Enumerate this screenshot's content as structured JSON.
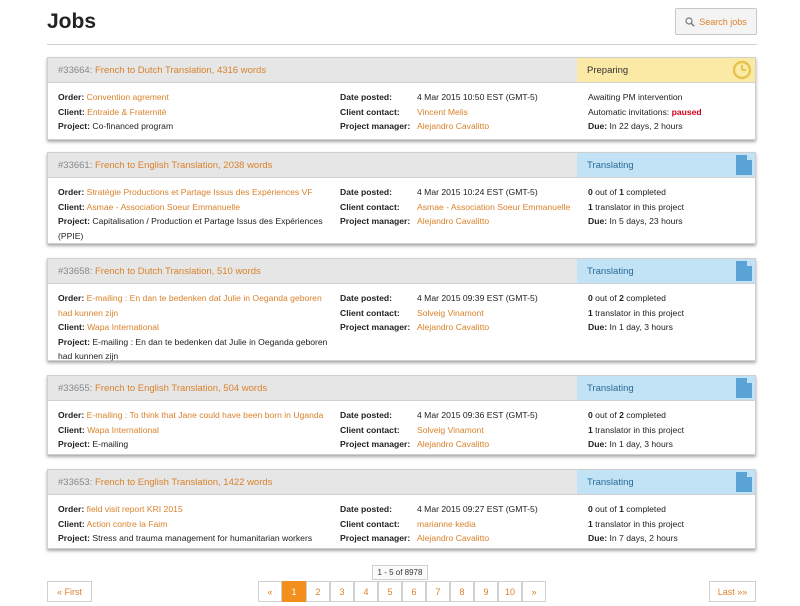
{
  "header": {
    "title": "Jobs",
    "search_label": "Search jobs"
  },
  "labels": {
    "order": "Order:",
    "client": "Client:",
    "project": "Project:",
    "date_posted": "Date posted:",
    "client_contact": "Client contact:",
    "project_manager": "Project manager:",
    "due": "Due:"
  },
  "jobs": [
    {
      "num": "#33664:",
      "title": "French to Dutch Translation, 4316 words",
      "status": "Preparing",
      "order": "Convention agrement",
      "client": "Entraide & Fraternité",
      "project": "Co-financed program",
      "date_posted": "4 Mar 2015 10:50 EST (GMT-5)",
      "client_contact": "Vincent Melis",
      "project_manager": "Alejandro Cavalitto",
      "info1": "Awaiting PM intervention",
      "info2_prefix": "Automatic invitations: ",
      "info2_value": "paused",
      "due": "In 22 days, 2 hours"
    },
    {
      "num": "#33661:",
      "title": "French to English Translation, 2038 words",
      "status": "Translating",
      "order": "Stratégie Productions et Partage Issus des Expériences VF",
      "client": "Asmae - Association Soeur Emmanuelle",
      "project": "Capitalisation / Production et Partage Issus des Expériences (PPIE)",
      "date_posted": "4 Mar 2015 10:24 EST (GMT-5)",
      "client_contact": "Asmae - Association Soeur Emmanuelle",
      "project_manager": "Alejandro Cavalitto",
      "completed_num": "0",
      "completed_mid": " out of ",
      "completed_total": "1",
      "completed_suffix": " completed",
      "translator_num": "1",
      "translator_text": " translator in this project",
      "due": "In 5 days, 23 hours"
    },
    {
      "num": "#33658:",
      "title": "French to Dutch Translation, 510 words",
      "status": "Translating",
      "order": "E-mailing : En dan te bedenken dat Julie in Oeganda geboren had kunnen zijn",
      "client": "Wapa International",
      "project": "E-mailing : En dan te bedenken dat Julie in Oeganda geboren had kunnen zijn",
      "date_posted": "4 Mar 2015 09:39 EST (GMT-5)",
      "client_contact": "Solveig Vinamont",
      "project_manager": "Alejandro Cavalitto",
      "completed_num": "0",
      "completed_mid": " out of ",
      "completed_total": "2",
      "completed_suffix": " completed",
      "translator_num": "1",
      "translator_text": " translator in this project",
      "due": "In 1 day, 3 hours"
    },
    {
      "num": "#33655:",
      "title": "French to English Translation, 504 words",
      "status": "Translating",
      "order": "E-mailing : To think that Jane could have been born in Uganda",
      "client": "Wapa International",
      "project": "E-mailing",
      "date_posted": "4 Mar 2015 09:36 EST (GMT-5)",
      "client_contact": "Solveig Vinamont",
      "project_manager": "Alejandro Cavalitto",
      "completed_num": "0",
      "completed_mid": " out of ",
      "completed_total": "2",
      "completed_suffix": " completed",
      "translator_num": "1",
      "translator_text": " translator in this project",
      "due": "In 1 day, 3 hours"
    },
    {
      "num": "#33653:",
      "title": "French to English Translation, 1422 words",
      "status": "Translating",
      "order": "field visit report KRI 2015",
      "client": "Action contre la Faim",
      "project": "Stress and trauma management for humanitarian workers",
      "date_posted": "4 Mar 2015 09:27 EST (GMT-5)",
      "client_contact": "marianne kedia",
      "project_manager": "Alejandro Cavalitto",
      "completed_num": "0",
      "completed_mid": " out of ",
      "completed_total": "1",
      "completed_suffix": " completed",
      "translator_num": "1",
      "translator_text": " translator in this project",
      "due": "In 7 days, 2 hours"
    }
  ],
  "pagination": {
    "range": "1 - 5 of 8978",
    "first": "« First",
    "prev": "«",
    "pages": [
      "1",
      "2",
      "3",
      "4",
      "5",
      "6",
      "7",
      "8",
      "9",
      "10"
    ],
    "active_page": "1",
    "next": "»",
    "last": "Last »»"
  },
  "colors": {
    "accent": "#d9822b",
    "preparing_bg": "#fbe9a6",
    "translating_bg": "#c2e3f6",
    "paused": "#d0021b"
  }
}
